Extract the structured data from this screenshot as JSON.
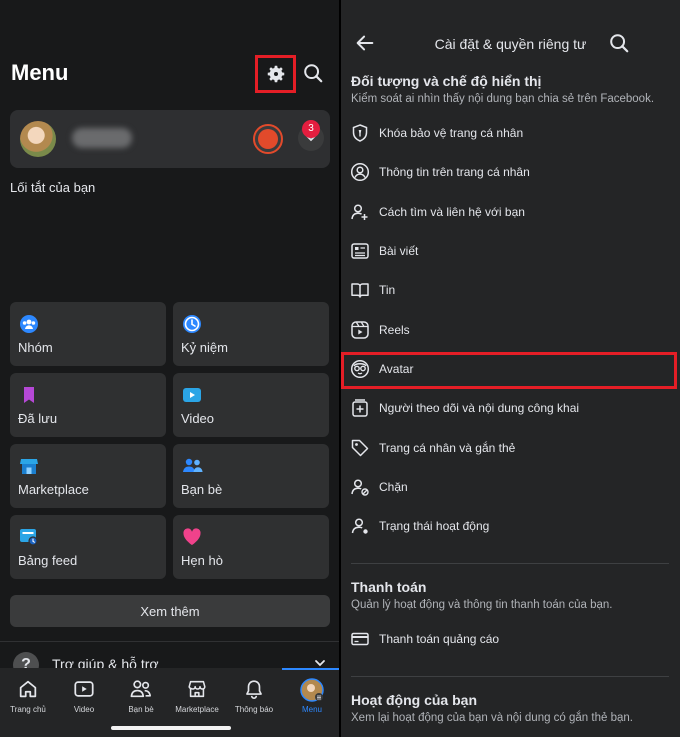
{
  "left": {
    "title": "Menu",
    "notification_count": "3",
    "shortcuts_label": "Lối tắt của bạn",
    "tiles": [
      {
        "label": "Nhóm",
        "icon": "groups-icon"
      },
      {
        "label": "Kỷ niệm",
        "icon": "memories-clock-icon"
      },
      {
        "label": "Đã lưu",
        "icon": "bookmark-icon"
      },
      {
        "label": "Video",
        "icon": "video-play-icon"
      },
      {
        "label": "Marketplace",
        "icon": "marketplace-shop-icon"
      },
      {
        "label": "Bạn bè",
        "icon": "friends-icon"
      },
      {
        "label": "Bảng feed",
        "icon": "feeds-icon"
      },
      {
        "label": "Hẹn hò",
        "icon": "heart-icon"
      }
    ],
    "see_more": "Xem thêm",
    "help": "Trợ giúp & hỗ trợ",
    "nav": [
      {
        "label": "Trang chủ"
      },
      {
        "label": "Video"
      },
      {
        "label": "Bạn bè"
      },
      {
        "label": "Marketplace"
      },
      {
        "label": "Thông báo"
      },
      {
        "label": "Menu"
      }
    ],
    "colors": {
      "accent": "#2d88ff",
      "highlight": "#e41e26",
      "badge": "#e41e3f"
    }
  },
  "right": {
    "header_title": "Cài đặt & quyền riêng tư",
    "section1": {
      "title": "Đối tượng và chế độ hiển thị",
      "subtitle": "Kiểm soát ai nhìn thấy nội dung bạn chia sẻ trên Facebook.",
      "items": [
        {
          "label": "Khóa bảo vệ trang cá nhân"
        },
        {
          "label": "Thông tin trên trang cá nhân"
        },
        {
          "label": "Cách tìm và liên hệ với bạn"
        },
        {
          "label": "Bài viết"
        },
        {
          "label": "Tin"
        },
        {
          "label": "Reels"
        },
        {
          "label": "Avatar"
        },
        {
          "label": "Người theo dõi và nội dung công khai"
        },
        {
          "label": "Trang cá nhân và gắn thẻ"
        },
        {
          "label": "Chặn"
        },
        {
          "label": "Trạng thái hoạt động"
        }
      ]
    },
    "section2": {
      "title": "Thanh toán",
      "subtitle": "Quản lý hoạt động và thông tin thanh toán của bạn.",
      "items": [
        {
          "label": "Thanh toán quảng cáo"
        }
      ]
    },
    "section3": {
      "title": "Hoạt động của bạn",
      "subtitle": "Xem lại hoạt động của bạn và nội dung có gắn thẻ bạn."
    }
  }
}
